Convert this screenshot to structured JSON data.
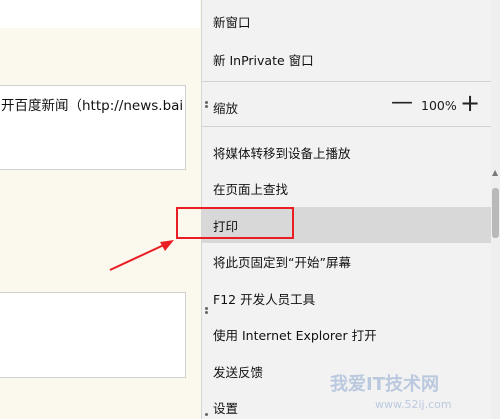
{
  "page": {
    "address_text": "开百度新闻（http://news.bai"
  },
  "menu": {
    "items": [
      {
        "label": "新窗口"
      },
      {
        "label": "新 InPrivate 窗口"
      },
      {
        "label": "将媒体转移到设备上播放"
      },
      {
        "label": "在页面上查找"
      },
      {
        "label": "打印"
      },
      {
        "label": "将此页固定到“开始”屏幕"
      },
      {
        "label": "F12 开发人员工具"
      },
      {
        "label": "使用 Internet Explorer 打开"
      },
      {
        "label": "发送反馈"
      },
      {
        "label": "设置"
      }
    ],
    "zoom": {
      "label": "缩放",
      "value": "100%",
      "minus_icon": "minus-icon",
      "plus_icon": "plus-icon"
    }
  },
  "annotation": {
    "highlight_color": "#ea1c24"
  },
  "watermark": {
    "text": "我爱IT技术网",
    "url": "www.52ij.com"
  }
}
